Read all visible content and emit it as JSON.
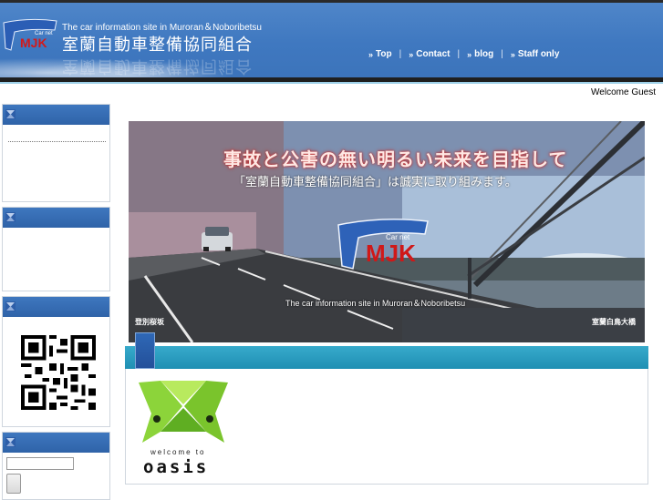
{
  "header": {
    "tagline": "The car information site in Muroran＆Noboribetsu",
    "title": "室蘭自動車整備協同組合",
    "logo_text": "MJK",
    "logo_small": "Car net"
  },
  "nav": {
    "items": [
      {
        "label": "Top"
      },
      {
        "label": "Contact"
      },
      {
        "label": "blog"
      },
      {
        "label": "Staff only"
      }
    ]
  },
  "welcome": "Welcome Guest",
  "banner": {
    "headline": "事故と公害の無い明るい未来を目指して",
    "subline": "「室蘭自動車整備協同組合」は誠実に取り組みます。",
    "logo_text": "MJK",
    "logo_small": "Car net",
    "tagline": "The car information site in Muroran＆Noboribetsu",
    "caption_left": "登別桜坂",
    "caption_right": "室蘭白鳥大橋"
  },
  "oasis": {
    "small": "welcome to",
    "big": "oasis"
  },
  "colors": {
    "header_blue": "#3f78c0",
    "content_bar": "#2a9dc2",
    "logo_red": "#d21a1a",
    "oasis_green": "#8cd43a"
  }
}
